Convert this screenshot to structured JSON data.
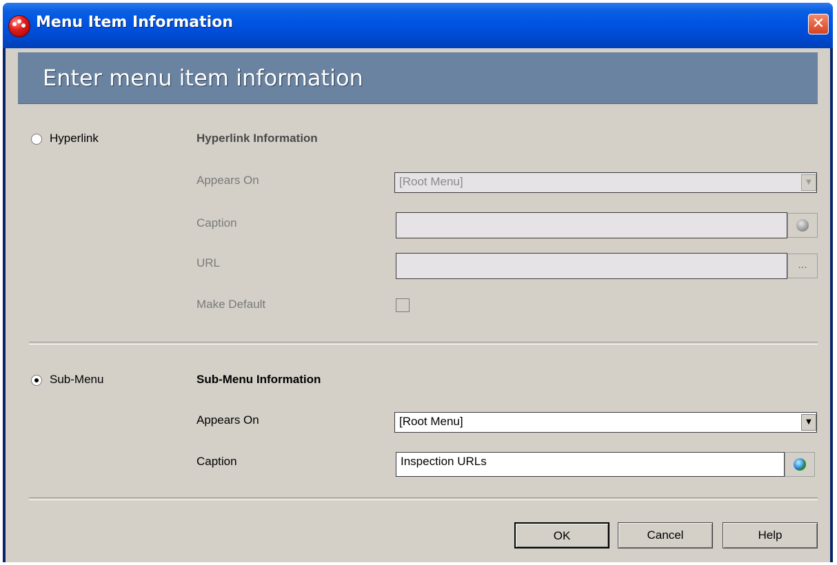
{
  "window": {
    "title": "Menu Item Information",
    "close_glyph": "✕"
  },
  "banner": {
    "text": "Enter menu item information"
  },
  "hyperlink": {
    "radio_label": "Hyperlink",
    "selected": false,
    "heading": "Hyperlink Information",
    "appears_on_label": "Appears On",
    "appears_on_value": "[Root Menu]",
    "caption_label": "Caption",
    "caption_value": "",
    "url_label": "URL",
    "url_value": "",
    "url_browse_label": "...",
    "make_default_label": "Make Default",
    "make_default_checked": false,
    "enabled": false
  },
  "submenu": {
    "radio_label": "Sub-Menu",
    "selected": true,
    "heading": "Sub-Menu Information",
    "appears_on_label": "Appears On",
    "appears_on_value": "[Root Menu]",
    "caption_label": "Caption",
    "caption_value": "Inspection URLs",
    "enabled": true
  },
  "buttons": {
    "ok": "OK",
    "cancel": "Cancel",
    "help": "Help"
  },
  "icons": {
    "app": "app-icon",
    "globe_disabled": "globe-icon",
    "globe_active": "globe-icon",
    "dropdown": "chevron-down-icon",
    "close": "close-icon"
  },
  "colors": {
    "titlebar": "#0054e3",
    "banner": "#6a83a0",
    "client": "#d4d0c8",
    "disabled_field": "#e6e3e6",
    "close": "#d7421e"
  }
}
